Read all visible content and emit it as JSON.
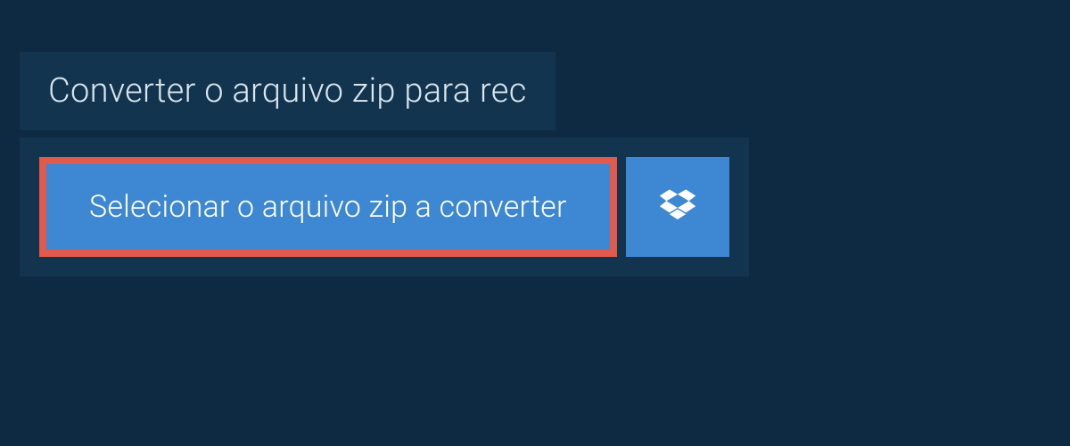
{
  "header": {
    "title": "Converter o arquivo zip para rec"
  },
  "main": {
    "select_button_label": "Selecionar o arquivo zip a converter"
  }
}
